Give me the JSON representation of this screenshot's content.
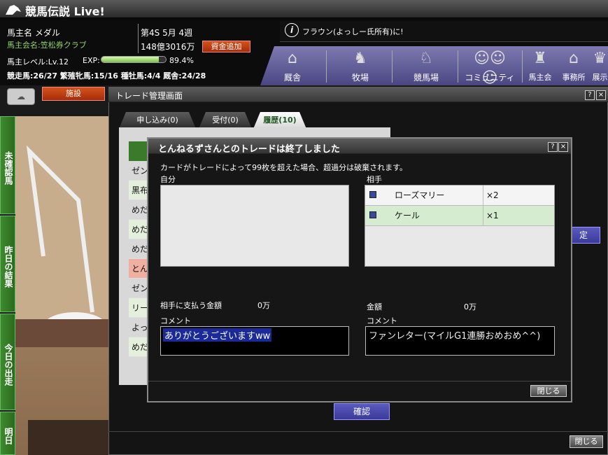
{
  "app": {
    "title": "競馬伝説 Live!"
  },
  "header": {
    "owner_name": "馬主名 メダル",
    "club_name": "馬主会名:笠松券クラブ",
    "week": "第4S 5月 4週",
    "money": "148億3016万",
    "fund_button": "資金追加",
    "level": "馬主レベル:Lv.12",
    "exp_label": "EXP:",
    "exp_value": "89.4%",
    "exp_fraction": 0.894,
    "status": "競走馬:26/27 繁殖牝馬:15/16 種牡馬:4/4 厩舎:24/28",
    "notice": "フラウン(よっしー氏所有)に!",
    "facility_button": "施設"
  },
  "nav": {
    "items": [
      {
        "label": "厩舎"
      },
      {
        "label": "牧場"
      },
      {
        "label": "競馬場"
      },
      {
        "label": "コミュニティ"
      },
      {
        "label": "馬主会"
      },
      {
        "label": "事務所"
      },
      {
        "label": "展示"
      }
    ]
  },
  "side_tabs": [
    "未確認馬",
    "昨日の結果",
    "今日の出走",
    "明日"
  ],
  "trade": {
    "title": "トレード管理画面",
    "tabs": [
      {
        "label": "申し込み(0)"
      },
      {
        "label": "受付(0)"
      },
      {
        "label": "履歴(10)"
      }
    ],
    "list": [
      "ゼン",
      "黒布",
      "めだ",
      "めだ",
      "めだ",
      "とん",
      "ゼン",
      "リー",
      "よっ",
      "めだ"
    ],
    "confirm_right": "定",
    "confirm_button": "確認",
    "close_button": "閉じる"
  },
  "dialog": {
    "title": "とんねるずさんとのトレードは終了しました",
    "note": "カードがトレードによって99枚を超えた場合、超過分は破棄されます。",
    "self_label": "自分",
    "partner_label": "相手",
    "partner_items": [
      {
        "name": "ローズマリー",
        "qty": "×2"
      },
      {
        "name": "ケール",
        "qty": "×1"
      }
    ],
    "pay_label": "相手に支払う金額",
    "pay_value": "0万",
    "amount_label": "金額",
    "amount_value": "0万",
    "comment_label": "コメント",
    "self_comment": "ありがとうございますww",
    "partner_comment": "ファンレター(マイルG1連勝おめおめ^^)",
    "close_button": "閉じる"
  }
}
